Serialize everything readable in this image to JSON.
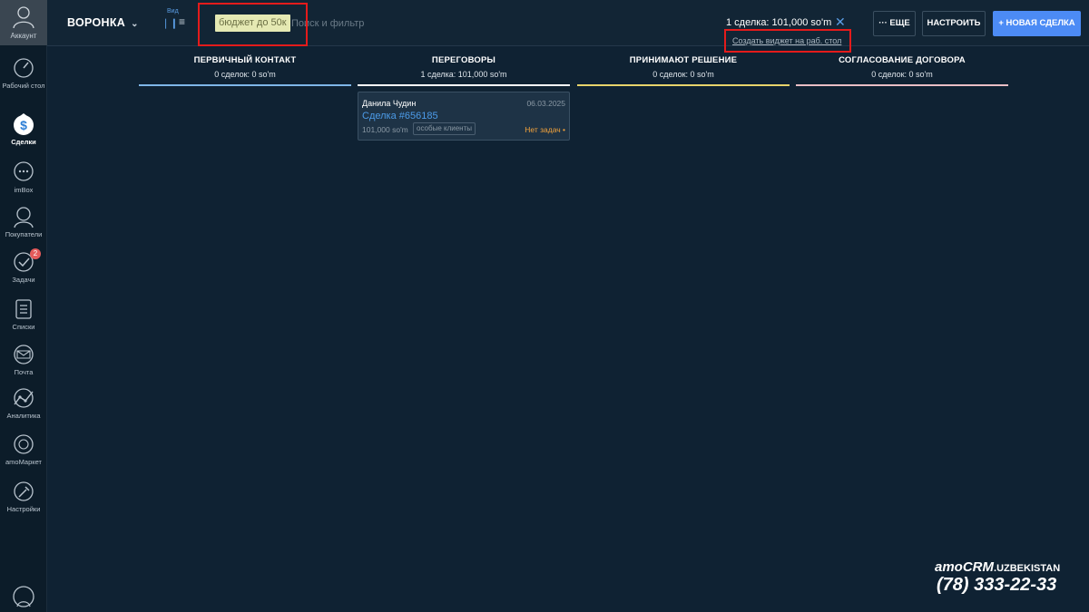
{
  "sidebar": {
    "account_label": "Аккаунт",
    "items": [
      {
        "label": "Рабочий стол",
        "icon": "dashboard-icon"
      },
      {
        "label": "Сделки",
        "icon": "deals-icon",
        "active": true
      },
      {
        "label": "imBox",
        "icon": "chat-icon"
      },
      {
        "label": "Покупатели",
        "icon": "customers-icon"
      },
      {
        "label": "Задачи",
        "icon": "tasks-icon",
        "badge": "2"
      },
      {
        "label": "Списки",
        "icon": "lists-icon"
      },
      {
        "label": "Почта",
        "icon": "mail-icon"
      },
      {
        "label": "Аналитика",
        "icon": "analytics-icon"
      },
      {
        "label": "amoМаркет",
        "icon": "market-icon"
      },
      {
        "label": "Настройки",
        "icon": "settings-icon"
      }
    ]
  },
  "header": {
    "pipeline_label": "ВОРОНКА",
    "view_label": "Вид",
    "filter_chip": "бюджет до 50к",
    "search_placeholder": "Поиск и фильтр",
    "summary": "1 сделка: 101,000 so'm",
    "widget_link": "Создать виджет на раб. стол",
    "more_label": "··· ЕЩЕ",
    "settings_label": "НАСТРОИТЬ",
    "new_deal_label": "+ НОВАЯ СДЕЛКА"
  },
  "columns": [
    {
      "title": "ПЕРВИЧНЫЙ КОНТАКТ",
      "stat": "0 сделок: 0 so'm",
      "color": "#7fb6e8"
    },
    {
      "title": "ПЕРЕГОВОРЫ",
      "stat": "1 сделка: 101,000 so'm",
      "color": "#ffffff"
    },
    {
      "title": "ПРИНИМАЮТ РЕШЕНИЕ",
      "stat": "0 сделок: 0 so'm",
      "color": "#e8d36b"
    },
    {
      "title": "СОГЛАСОВАНИЕ ДОГОВОРА",
      "stat": "0 сделок: 0 so'm",
      "color": "#e9bfc6"
    }
  ],
  "card": {
    "contact": "Данила Чудин",
    "date": "06.03.2025",
    "deal_link": "Сделка #656185",
    "price": "101,000 so'm",
    "tag": "особые клиенты",
    "task_status": "Нет задач •"
  },
  "watermark": {
    "brand": "amoCRM",
    "suffix": ".UZBEKISTAN",
    "phone": "(78) 333-22-33"
  }
}
